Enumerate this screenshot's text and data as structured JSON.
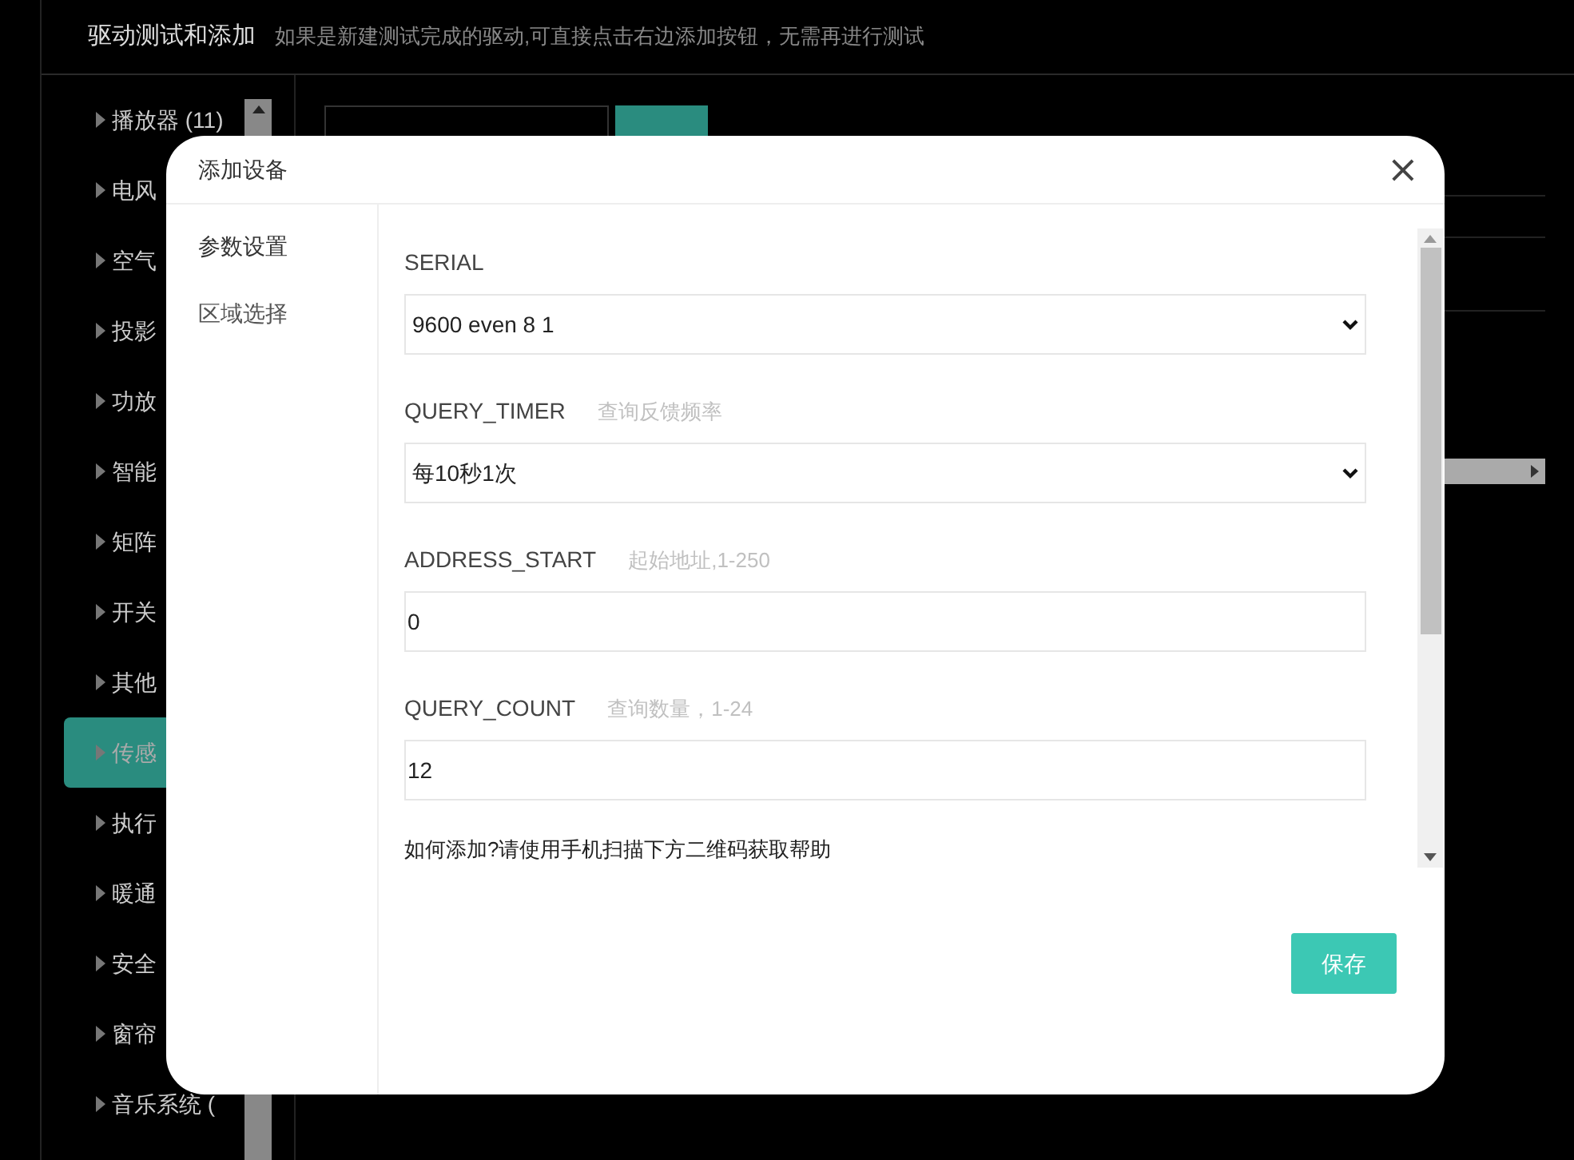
{
  "header": {
    "title": "驱动测试和添加",
    "subtitle": "如果是新建测试完成的驱动,可直接点击右边添加按钮，无需再进行测试"
  },
  "sidebar": {
    "items": [
      {
        "label": "播放器 (11)",
        "selected": false
      },
      {
        "label": "电风",
        "selected": false
      },
      {
        "label": "空气",
        "selected": false
      },
      {
        "label": "投影",
        "selected": false
      },
      {
        "label": "功放",
        "selected": false
      },
      {
        "label": "智能",
        "selected": false
      },
      {
        "label": "矩阵",
        "selected": false
      },
      {
        "label": "开关",
        "selected": false
      },
      {
        "label": "其他",
        "selected": false
      },
      {
        "label": "传感",
        "selected": true
      },
      {
        "label": "执行",
        "selected": false
      },
      {
        "label": "暖通",
        "selected": false
      },
      {
        "label": "安全",
        "selected": false
      },
      {
        "label": "窗帘",
        "selected": false
      },
      {
        "label": "音乐系统 (",
        "selected": false
      }
    ]
  },
  "dialog": {
    "title": "添加设备",
    "close": "×",
    "nav": [
      {
        "label": "参数设置",
        "selected": true
      },
      {
        "label": "区域选择",
        "selected": false
      }
    ],
    "fields": [
      {
        "kind": "select",
        "label": "SERIAL",
        "value": "9600 even 8 1"
      },
      {
        "kind": "select",
        "label": "QUERY_TIMER",
        "hint": "查询反馈频率",
        "value": "每10秒1次"
      },
      {
        "kind": "input",
        "label": "ADDRESS_START",
        "hint": "起始地址,1-250",
        "value": "0"
      },
      {
        "kind": "input",
        "label": "QUERY_COUNT",
        "hint": "查询数量，1-24",
        "value": "12"
      }
    ],
    "help": "如何添加?请使用手机扫描下方二维码获取帮助",
    "save": "保存"
  }
}
